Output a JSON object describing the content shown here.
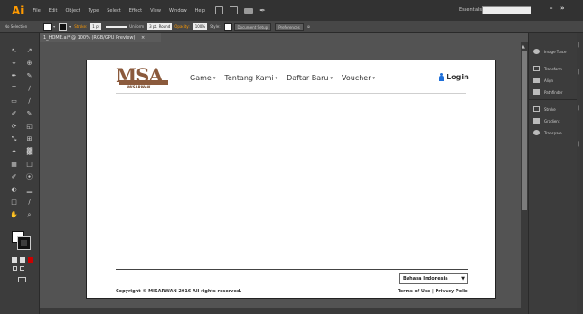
{
  "app": {
    "logo": "Ai",
    "menu": [
      "File",
      "Edit",
      "Object",
      "Type",
      "Select",
      "Effect",
      "View",
      "Window",
      "Help"
    ],
    "workspace": "Essentials",
    "window_controls": {
      "minimize": "–",
      "maximize": "»"
    }
  },
  "control_bar": {
    "selection": "No Selection",
    "stroke_label": "Stroke:",
    "stroke_weight": "1 pt",
    "profile": "Uniform",
    "brush": "3 pt. Round",
    "opacity_label": "Opacity:",
    "opacity": "100%",
    "style_label": "Style:",
    "document_setup": "Document Setup",
    "preferences": "Preferences"
  },
  "document": {
    "tab_title": "1_HOME.ai* @ 100% (RGB/GPU Preview)",
    "close": "×"
  },
  "site": {
    "logo_text": "MSA",
    "logo_sub": "MISARWAN",
    "nav": [
      {
        "label": "Game",
        "caret": "▾"
      },
      {
        "label": "Tentang Kami",
        "caret": "▾"
      },
      {
        "label": "Daftar Baru",
        "caret": "▾"
      },
      {
        "label": "Voucher",
        "caret": "▾"
      }
    ],
    "login": "Login",
    "language": "Bahasa Indonesia",
    "language_arrow": "▼",
    "copyright": "Copyright © MISARWAN 2016 All rights reserved.",
    "footer_links": "Terms of Use | Privacy Polic"
  },
  "panels": [
    {
      "label": "Image Trace"
    },
    {
      "label": "Transform"
    },
    {
      "label": "Align"
    },
    {
      "label": "Pathfinder"
    },
    {
      "label": "Stroke"
    },
    {
      "label": "Gradient"
    },
    {
      "label": "Transpare..."
    }
  ],
  "tools": [
    "↖",
    "↗",
    "⌖",
    "⊕",
    "✒",
    "✎",
    "T",
    "∕",
    "▭",
    "∕",
    "✐",
    "✎",
    "⟳",
    "◱",
    "⤡",
    "⊞",
    "✦",
    "▓",
    "▦",
    "□",
    "✐",
    "⦿",
    "◐",
    "▁",
    "◫",
    "∕",
    "✋",
    "⌕"
  ],
  "colors": {
    "accent": "#ff9a00",
    "logo_brown": "#8b5a3c",
    "login_icon": "#1e6fd9"
  }
}
